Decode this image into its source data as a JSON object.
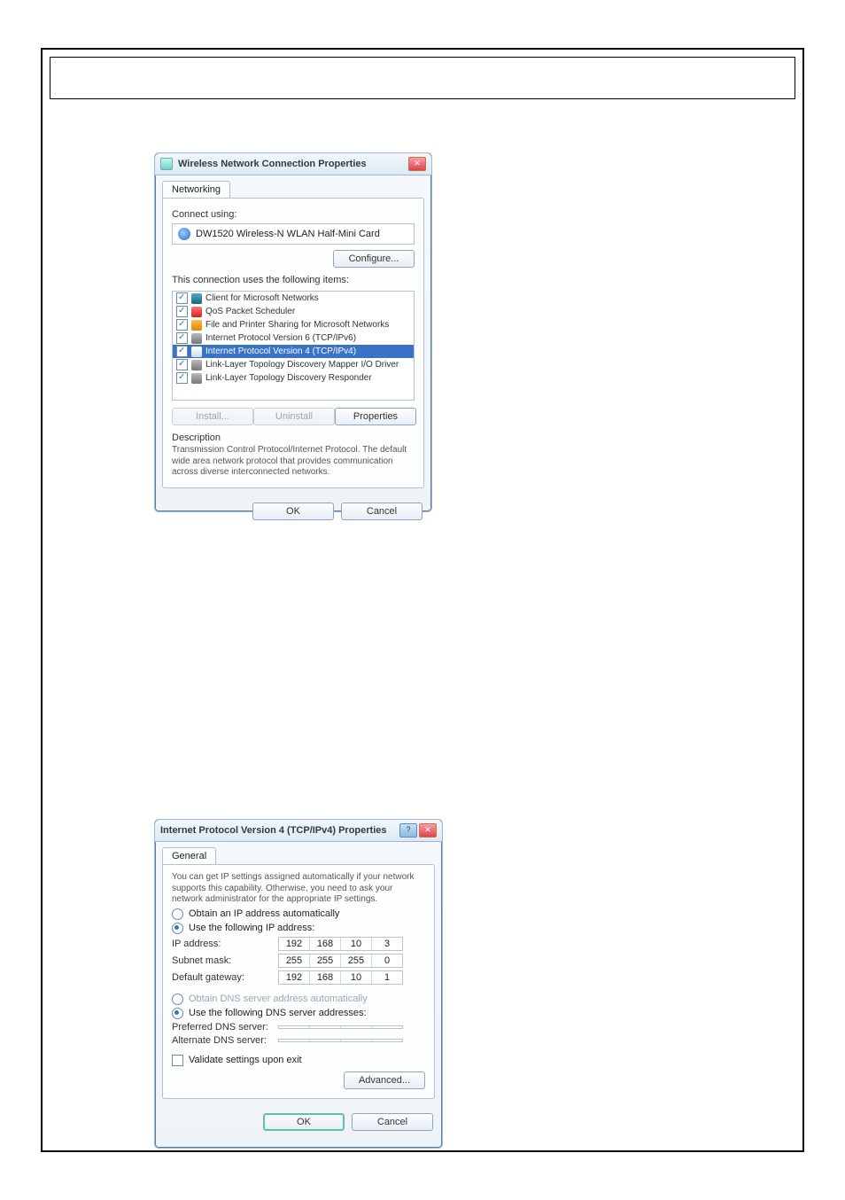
{
  "dlg1": {
    "title": "Wireless Network Connection Properties",
    "tab": "Networking",
    "connect_using_label": "Connect using:",
    "adapter": "DW1520 Wireless-N WLAN Half-Mini Card",
    "configure_btn": "Configure...",
    "items_label": "This connection uses the following items:",
    "items": [
      {
        "label": "Client for Microsoft Networks",
        "checked": true,
        "icon": "net"
      },
      {
        "label": "QoS Packet Scheduler",
        "checked": true,
        "icon": "qos"
      },
      {
        "label": "File and Printer Sharing for Microsoft Networks",
        "checked": true,
        "icon": "fp"
      },
      {
        "label": "Internet Protocol Version 6 (TCP/IPv6)",
        "checked": true,
        "icon": "ip"
      },
      {
        "label": "Internet Protocol Version 4 (TCP/IPv4)",
        "checked": true,
        "icon": "ip",
        "selected": true
      },
      {
        "label": "Link-Layer Topology Discovery Mapper I/O Driver",
        "checked": true,
        "icon": "ip"
      },
      {
        "label": "Link-Layer Topology Discovery Responder",
        "checked": true,
        "icon": "ip"
      }
    ],
    "install_btn": "Install...",
    "uninstall_btn": "Uninstall",
    "properties_btn": "Properties",
    "desc_head": "Description",
    "desc_text": "Transmission Control Protocol/Internet Protocol. The default wide area network protocol that provides communication across diverse interconnected networks.",
    "ok": "OK",
    "cancel": "Cancel"
  },
  "dlg2": {
    "title": "Internet Protocol Version 4 (TCP/IPv4) Properties",
    "tab": "General",
    "intro": "You can get IP settings assigned automatically if your network supports this capability. Otherwise, you need to ask your network administrator for the appropriate IP settings.",
    "r_auto_ip": "Obtain an IP address automatically",
    "r_use_ip": "Use the following IP address:",
    "ip_label": "IP address:",
    "ip": [
      "192",
      "168",
      "10",
      "3"
    ],
    "mask_label": "Subnet mask:",
    "mask": [
      "255",
      "255",
      "255",
      "0"
    ],
    "gw_label": "Default gateway:",
    "gw": [
      "192",
      "168",
      "10",
      "1"
    ],
    "r_auto_dns": "Obtain DNS server address automatically",
    "r_use_dns": "Use the following DNS server addresses:",
    "pdns_label": "Preferred DNS server:",
    "pdns": [
      "",
      "",
      "",
      ""
    ],
    "adns_label": "Alternate DNS server:",
    "adns": [
      "",
      "",
      "",
      ""
    ],
    "validate": "Validate settings upon exit",
    "advanced": "Advanced...",
    "ok": "OK",
    "cancel": "Cancel"
  }
}
